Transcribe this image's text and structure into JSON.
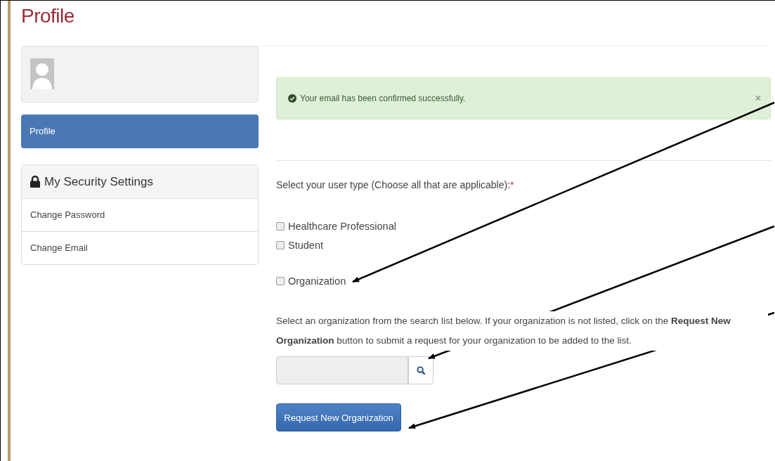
{
  "page_title": "Profile",
  "sidebar": {
    "nav": [
      {
        "label": "Profile",
        "selected": true
      }
    ],
    "security_panel": {
      "title": "My Security Settings",
      "items": [
        "Change Password",
        "Change Email"
      ]
    }
  },
  "alert": {
    "message": "Your email has been confirmed successfully.",
    "close": "×"
  },
  "user_type": {
    "label": "Select your user type (Choose all that are applicable):",
    "required_mark": "*",
    "options": [
      {
        "label": "Healthcare Professional",
        "checked": false
      },
      {
        "label": "Student",
        "checked": false
      },
      {
        "label": "Organization",
        "checked": false
      }
    ]
  },
  "organization": {
    "instructions": "Select an organization from the search list below. If your organization is not listed, click on the **Request New Organization** button to submit a request for your organization to be added to the list.",
    "button": "Request New Organization"
  }
}
